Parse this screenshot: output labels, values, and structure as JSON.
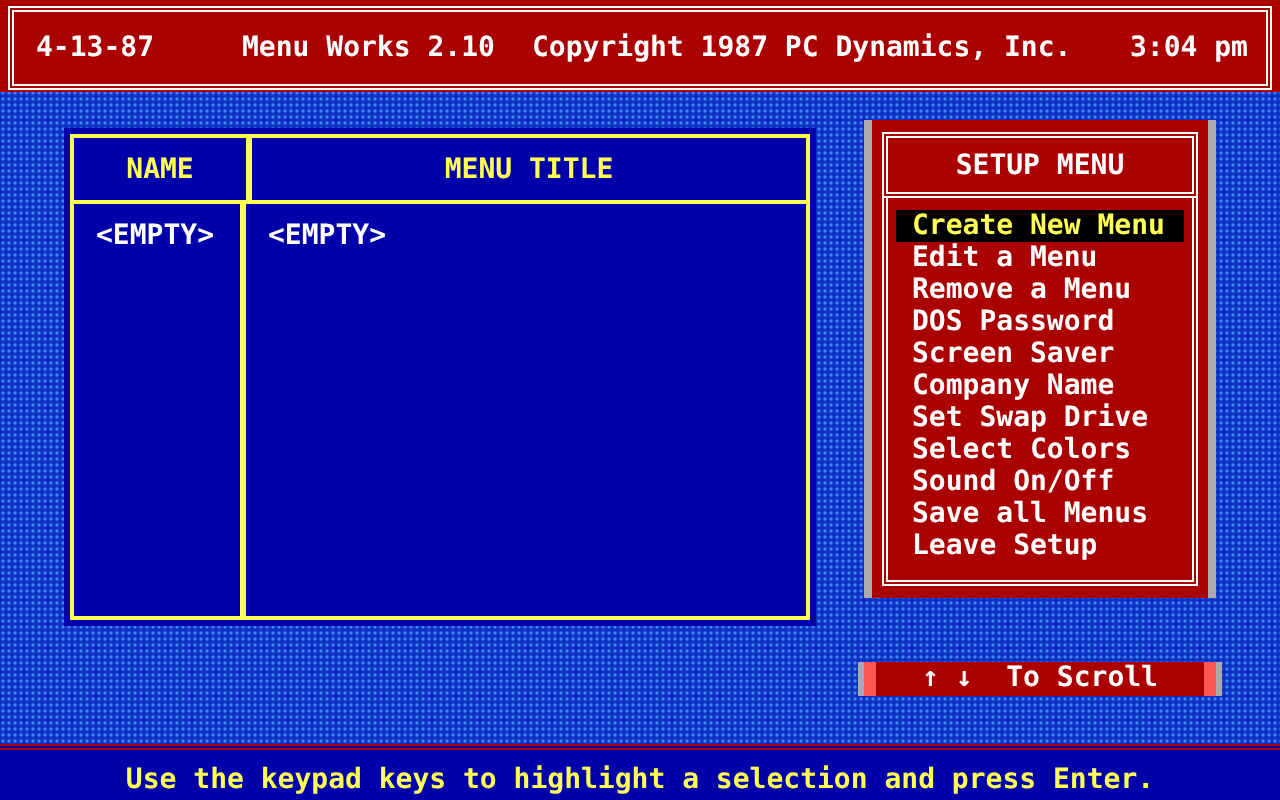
{
  "header": {
    "date": "4-13-87",
    "title": "Menu Works 2.10",
    "copyright": "Copyright 1987 PC Dynamics, Inc.",
    "time": "3:04 pm"
  },
  "table": {
    "columns": [
      "NAME",
      "MENU TITLE"
    ],
    "rows": [
      [
        "<EMPTY>",
        "<EMPTY>"
      ]
    ]
  },
  "setup_menu": {
    "title": "SETUP MENU",
    "items": [
      {
        "label": "Create New Menu",
        "selected": true
      },
      {
        "label": "Edit a Menu",
        "selected": false
      },
      {
        "label": "Remove a Menu",
        "selected": false
      },
      {
        "label": "DOS Password",
        "selected": false
      },
      {
        "label": "Screen Saver",
        "selected": false
      },
      {
        "label": "Company Name",
        "selected": false
      },
      {
        "label": "Set Swap Drive",
        "selected": false
      },
      {
        "label": "Select Colors",
        "selected": false
      },
      {
        "label": "Sound On/Off",
        "selected": false
      },
      {
        "label": "Save all Menus",
        "selected": false
      },
      {
        "label": "Leave Setup",
        "selected": false
      }
    ]
  },
  "scroll_hint": "↑ ↓  To Scroll",
  "status_bar": "Use the keypad keys to highlight a selection and press Enter."
}
